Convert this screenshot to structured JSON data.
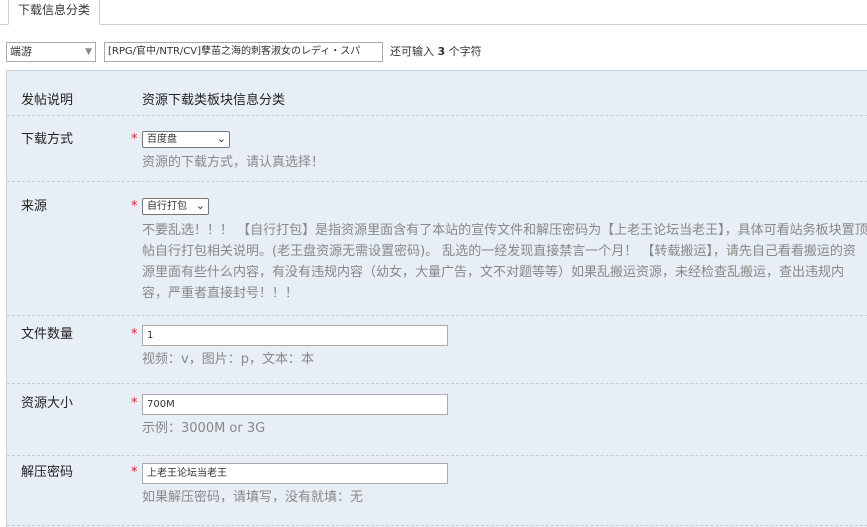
{
  "tab": {
    "label": "下载信息分类"
  },
  "post": {
    "type_selected": "端游",
    "title_value": "[RPG/官中/NTR/CV]孽苗之海的刺客淑女のレディ・スパ",
    "remain_prefix": "还可输入 ",
    "remain_count": "3",
    "remain_suffix": " 个字符"
  },
  "form": {
    "desc": {
      "label": "发帖说明",
      "value": "资源下载类板块信息分类"
    },
    "method": {
      "label": "下载方式",
      "required": "*",
      "selected": "百度盘",
      "hint": "资源的下载方式，请认真选择！"
    },
    "source": {
      "label": "来源",
      "required": "*",
      "selected": "自行打包",
      "hint": "不要乱选！！！ 【自行打包】是指资源里面含有了本站的宣传文件和解压密码为【上老王论坛当老王】，具体可看站务板块置顶帖自行打包相关说明。(老王盘资源无需设置密码)。 乱选的一经发现直接禁言一个月！ 【转载搬运】，请先自己看看搬运的资源里面有些什么内容，有没有违规内容（幼女，大量广告，文不对题等等）如果乱搬运资源，未经检查乱搬运，查出违规内容，严重者直接封号！！！"
    },
    "count": {
      "label": "文件数量",
      "required": "*",
      "value": "1",
      "hint": "视频：v，图片：p，文本：本"
    },
    "size": {
      "label": "资源大小",
      "required": "*",
      "value": "700M",
      "hint": "示例：3000M or 3G"
    },
    "password": {
      "label": "解压密码",
      "required": "*",
      "value": "上老王论坛当老王",
      "hint": "如果解压密码，请填写，没有就填：无"
    }
  },
  "icons": {
    "dropdown": "chevron-down-icon",
    "select_arrow": "triangle-down-icon"
  }
}
